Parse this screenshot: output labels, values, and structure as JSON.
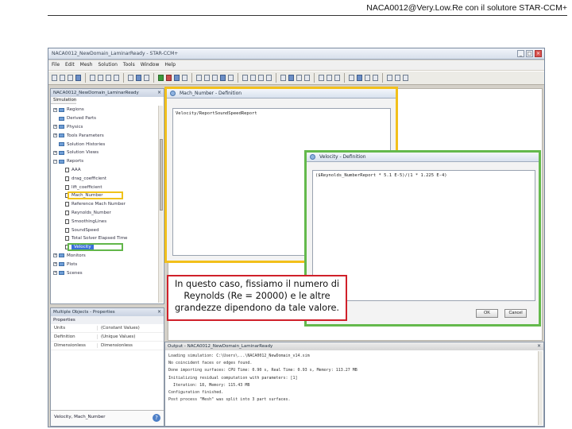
{
  "slide": {
    "header": "NACA0012@Very.Low.Re con il solutore STAR-CCM+"
  },
  "app": {
    "title": "NACA0012_NewDomain_LaminarReady - STAR-CCM+",
    "menu": [
      "File",
      "Edit",
      "Mesh",
      "Solution",
      "Tools",
      "Window",
      "Help"
    ]
  },
  "simulation_panel": {
    "title": "NACA0012_NewDomain_LaminarReady",
    "tab": "Simulation",
    "tree": [
      {
        "label": "Regions",
        "kind": "folder",
        "expander": "+",
        "level": 1
      },
      {
        "label": "Derived Parts",
        "kind": "folder",
        "expander": "",
        "level": 1
      },
      {
        "label": "Physics",
        "kind": "folder",
        "expander": "+",
        "level": 1
      },
      {
        "label": "Tools Parameters",
        "kind": "folder",
        "expander": "+",
        "level": 1
      },
      {
        "label": "Solution Histories",
        "kind": "folder",
        "expander": "",
        "level": 1
      },
      {
        "label": "Solution Views",
        "kind": "folder",
        "expander": "+",
        "level": 1
      },
      {
        "label": "Reports",
        "kind": "folder",
        "expander": "−",
        "level": 1
      },
      {
        "label": "AAA",
        "kind": "fn",
        "expander": "",
        "level": 2
      },
      {
        "label": "drag_coefficient",
        "kind": "fn",
        "expander": "",
        "level": 2
      },
      {
        "label": "lift_coefficient",
        "kind": "fn",
        "expander": "",
        "level": 2
      },
      {
        "label": "Mach_Number",
        "kind": "fn",
        "expander": "",
        "level": 2,
        "highlight": "yellow"
      },
      {
        "label": "Reference Mach Number",
        "kind": "fn",
        "expander": "",
        "level": 2
      },
      {
        "label": "Reynolds_Number",
        "kind": "fn",
        "expander": "",
        "level": 2
      },
      {
        "label": "SmoothingLines",
        "kind": "fn",
        "expander": "",
        "level": 2
      },
      {
        "label": "SoundSpeed",
        "kind": "fn",
        "expander": "",
        "level": 2
      },
      {
        "label": "Total Solver Elapsed Time",
        "kind": "fn",
        "expander": "",
        "level": 2
      },
      {
        "label": "Velocity",
        "kind": "fn",
        "expander": "",
        "level": 2,
        "highlight": "green"
      },
      {
        "label": "Monitors",
        "kind": "folder",
        "expander": "+",
        "level": 1
      },
      {
        "label": "Plots",
        "kind": "folder",
        "expander": "+",
        "level": 1
      },
      {
        "label": "Scenes",
        "kind": "folder",
        "expander": "+",
        "level": 1
      }
    ]
  },
  "properties_panel": {
    "title": "Multiple Objects - Properties",
    "group": "Properties",
    "rows": [
      {
        "key": "Units",
        "value": "(Constant Values)"
      },
      {
        "key": "Definition",
        "value": "(Unique Values)"
      },
      {
        "key": "Dimensionless",
        "value": "Dimensionless"
      }
    ],
    "footer": "Velocity, Mach_Number"
  },
  "mach_dialog": {
    "title": "Mach_Number - Definition",
    "expression": "Velocity/ReportSoundSpeedReport"
  },
  "velocity_dialog": {
    "title": "Velocity - Definition",
    "expression": "($Reynolds_NumberReport * 5.1 E-5)/(1 * 1.225 E-4)",
    "ok": "OK",
    "cancel": "Cancel"
  },
  "output": {
    "title": "Output - NACA0012_NewDomain_LaminarReady",
    "lines": [
      "Loading simulation: C:\\Users\\...\\NACA0012_NewDomain_v14.sim",
      "No coincident faces or edges found.",
      "Done importing surfaces: CPU Time: 0.90 s, Real Time: 0.93 s, Memory: 113.27 MB",
      "Initializing residual computation with parameters: [1]",
      "  Iteration: 18, Memory: 115.43 MB",
      "Configuration finished.",
      "Post process \"Mesh\" was split into 3 part surfaces."
    ]
  },
  "callout": {
    "text": "In questo caso, fissiamo il numero di Reynolds (Re = 20000) e le altre grandezze dipendono da tale valore."
  }
}
